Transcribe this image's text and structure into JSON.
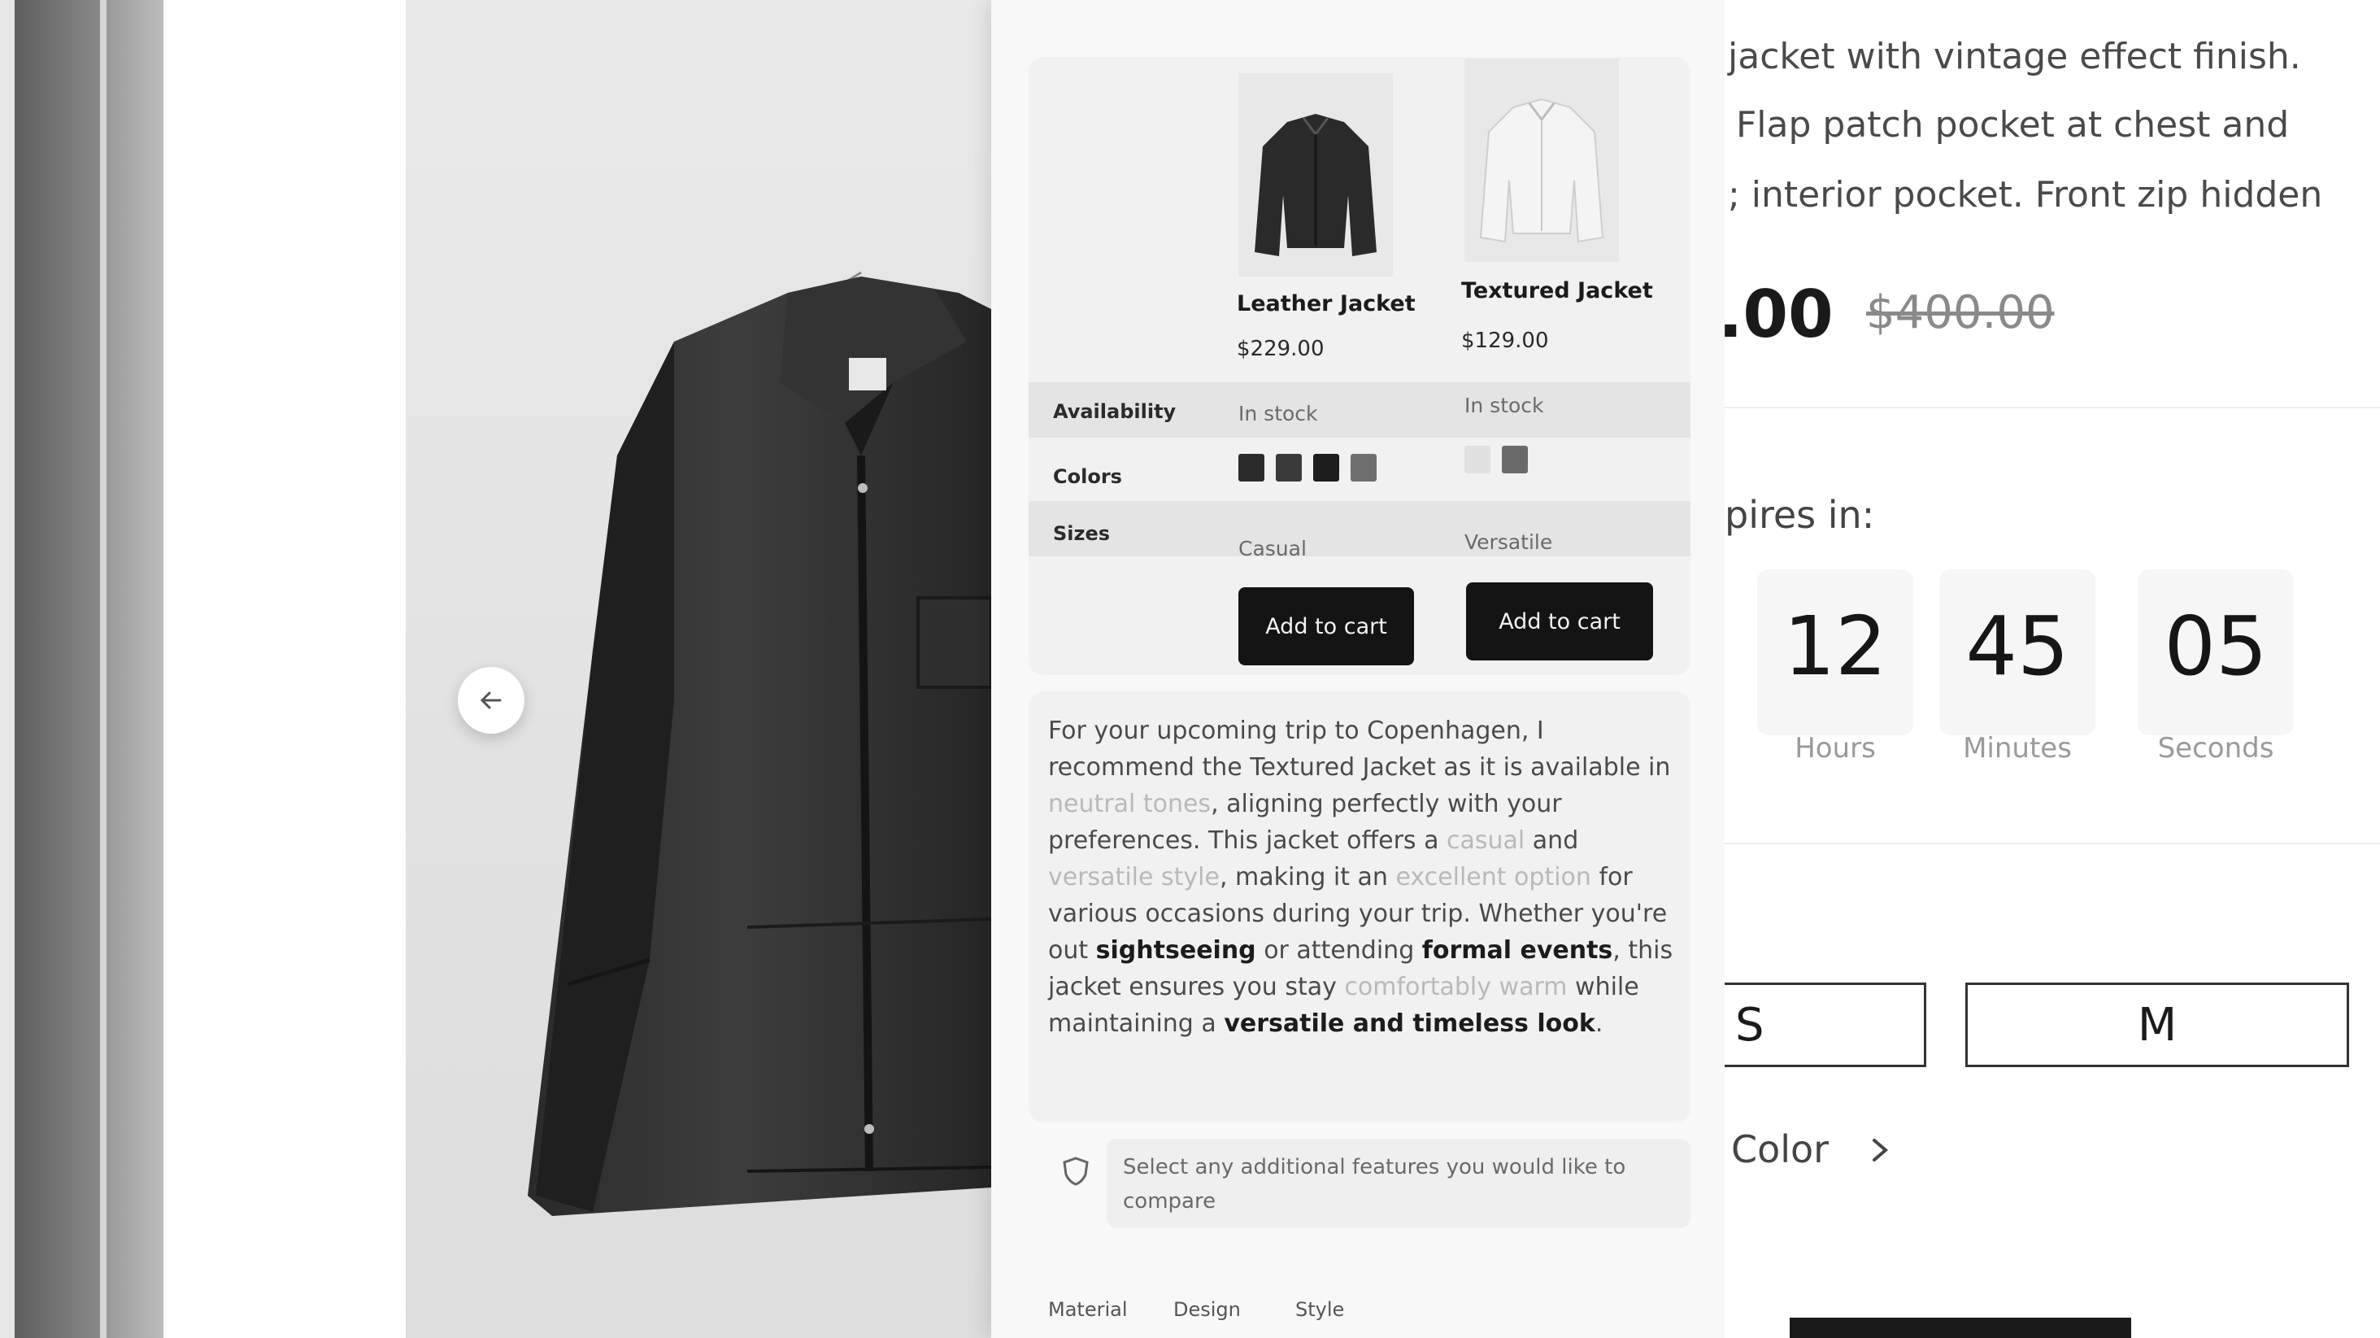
{
  "compare": {
    "products": [
      {
        "name": "Leather Jacket",
        "price": "$229.00",
        "availability": "In stock",
        "size_note": "Casual",
        "cart_label": "Add to cart",
        "swatches": [
          "#2b2b2b",
          "#3a3a3a",
          "#1d1d1d",
          "#6e6e6e"
        ]
      },
      {
        "name": "Textured Jacket",
        "price": "$129.00",
        "availability": "In stock",
        "size_note": "Versatile",
        "cart_label": "Add to cart",
        "swatches": [
          "#e1e1e1",
          "#6a6a6a"
        ]
      }
    ],
    "row_labels": {
      "availability": "Availability",
      "colors": "Colors",
      "sizes": "Sizes"
    }
  },
  "recommendation": {
    "segments": [
      {
        "text": "For your upcoming trip to Copenhagen, I recommend the Textured Jacket as it is available in ",
        "style": "normal"
      },
      {
        "text": "neutral tones",
        "style": "light"
      },
      {
        "text": ", aligning perfectly with your preferences. This jacket offers a ",
        "style": "normal"
      },
      {
        "text": "casual",
        "style": "light"
      },
      {
        "text": " and ",
        "style": "normal"
      },
      {
        "text": "versatile style",
        "style": "light"
      },
      {
        "text": ", making it an ",
        "style": "normal"
      },
      {
        "text": "excellent option",
        "style": "light"
      },
      {
        "text": " for various occasions during your trip. Whether you're out ",
        "style": "normal"
      },
      {
        "text": "sightseeing",
        "style": "bold"
      },
      {
        "text": " or attending ",
        "style": "normal"
      },
      {
        "text": "formal events",
        "style": "bold"
      },
      {
        "text": ", this jacket ensures you stay ",
        "style": "normal"
      },
      {
        "text": "comfortably warm",
        "style": "light"
      },
      {
        "text": " while maintaining a ",
        "style": "normal"
      },
      {
        "text": "versatile and timeless look",
        "style": "bold"
      },
      {
        "text": ".",
        "style": "normal"
      }
    ]
  },
  "features": {
    "prompt": "Select any additional features you would like to compare",
    "chips": [
      "Material",
      "Design",
      "Style"
    ]
  },
  "detail": {
    "description_lines": [
      "jacket with vintage effect finish.",
      "Flap patch pocket at chest and",
      "; interior pocket. Front zip hidden"
    ],
    "price_current": ".00",
    "price_original": "$400.00",
    "expires_label": "pires in:",
    "timer": {
      "hours": {
        "value": "12",
        "unit": "Hours"
      },
      "minutes": {
        "value": "45",
        "unit": "Minutes"
      },
      "seconds": {
        "value": "05",
        "unit": "Seconds"
      }
    },
    "sizes": [
      "S",
      "M"
    ],
    "color_link": "Color"
  },
  "icons": {
    "prev": "arrow-left-icon",
    "feature": "shield-icon",
    "color": "chevron-right-icon"
  }
}
